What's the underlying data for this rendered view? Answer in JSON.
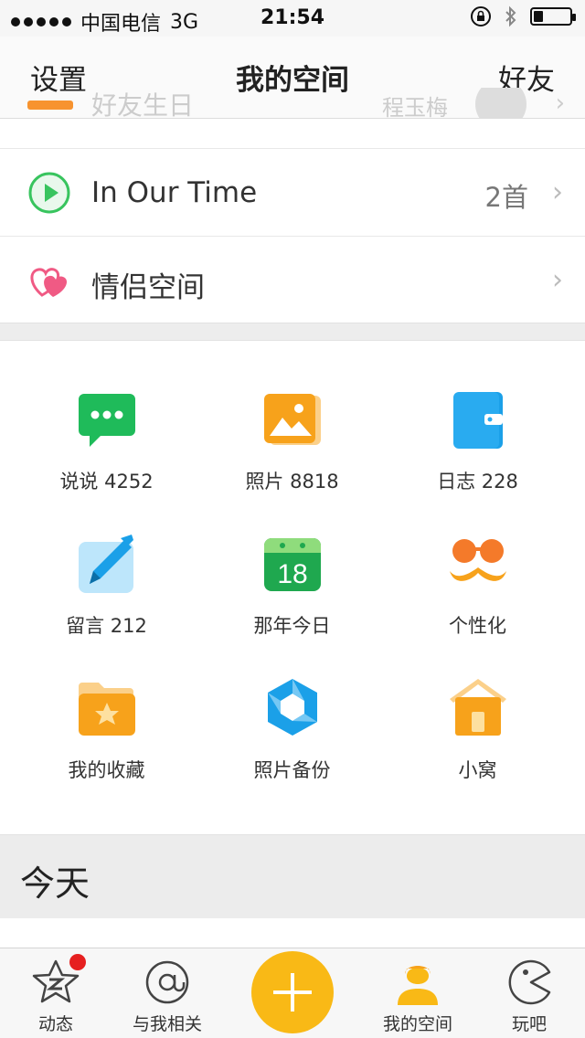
{
  "status_bar": {
    "carrier": "中国电信",
    "network": "3G",
    "time": "21:54",
    "battery_level": 0.25
  },
  "nav": {
    "left": "设置",
    "title": "我的空间",
    "right": "好友"
  },
  "ghost_row": {
    "label": "好友生日",
    "name": "程玉梅"
  },
  "list": [
    {
      "label": "In Our Time",
      "value": "2首",
      "icon": "play-icon"
    },
    {
      "label": "情侣空间",
      "value": "",
      "icon": "hearts-icon"
    }
  ],
  "grid": [
    {
      "label": "说说 4252",
      "icon": "chat-bubble-icon"
    },
    {
      "label": "照片 8818",
      "icon": "photo-icon"
    },
    {
      "label": "日志 228",
      "icon": "notebook-icon"
    },
    {
      "label": "留言 212",
      "icon": "pen-icon"
    },
    {
      "label": "那年今日",
      "icon": "calendar-icon",
      "day": "18"
    },
    {
      "label": "个性化",
      "icon": "mustache-glasses-icon"
    },
    {
      "label": "我的收藏",
      "icon": "star-folder-icon"
    },
    {
      "label": "照片备份",
      "icon": "backup-hexagon-icon"
    },
    {
      "label": "小窝",
      "icon": "house-icon"
    }
  ],
  "section_header": "今天",
  "tabs": [
    {
      "label": "动态",
      "icon": "star-z-icon",
      "badge": true
    },
    {
      "label": "与我相关",
      "icon": "at-icon"
    },
    {
      "label": "",
      "icon": "plus-icon"
    },
    {
      "label": "我的空间",
      "icon": "person-icon",
      "active": true
    },
    {
      "label": "玩吧",
      "icon": "pacman-icon"
    }
  ],
  "colors": {
    "accent": "#f9b916",
    "green": "#1fbb5a",
    "orange": "#f7a21b",
    "blue": "#1ba0e8",
    "badge": "#e62020"
  }
}
